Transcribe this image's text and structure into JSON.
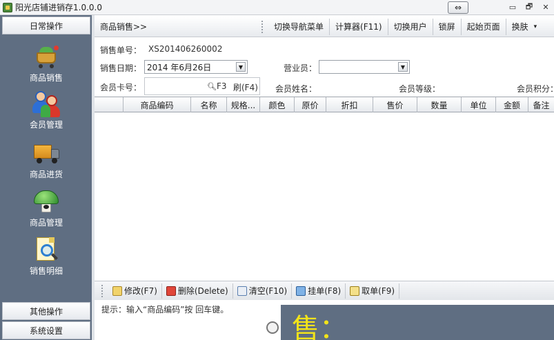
{
  "window": {
    "title": "阳光店铺进销存1.0.0.0",
    "nav_toggle": "⇔",
    "controls": [
      "▭",
      "🗗",
      "✕"
    ]
  },
  "sidebar": {
    "header": "日常操作",
    "items": [
      {
        "label": "商品销售",
        "icon": "shopping-cart-icon"
      },
      {
        "label": "会员管理",
        "icon": "members-icon"
      },
      {
        "label": "商品进货",
        "icon": "truck-icon"
      },
      {
        "label": "商品管理",
        "icon": "product-icon"
      },
      {
        "label": "销售明细",
        "icon": "sales-detail-icon"
      }
    ],
    "footer_items": [
      "其他操作",
      "系统设置"
    ]
  },
  "toolbar": {
    "breadcrumb": "商品销售>>",
    "buttons": [
      "切换导航菜单",
      "计算器(F11)",
      "切换用户",
      "锁屏",
      "起始页面",
      "换肤"
    ],
    "skin_dropdown": "▾"
  },
  "form": {
    "order_no_label": "销售单号：",
    "order_no": "XS201406260002",
    "date_label": "销售日期：",
    "date_value": "2014 年6月26日",
    "salesperson_label": "营业员：",
    "salesperson_value": "",
    "card_label": "会员卡号：",
    "card_value": "",
    "search_hint": "F3",
    "refresh": "刷(F4)",
    "member_name_label": "会员姓名：",
    "member_level_label": "会员等级：",
    "member_points_label": "会员积分："
  },
  "grid": {
    "columns": [
      "",
      "商品编码",
      "名称",
      "规格...",
      "颜色",
      "原价",
      "折扣",
      "售价",
      "数量",
      "单位",
      "金额",
      "备注"
    ],
    "rows": []
  },
  "actions": [
    "修改(F7)",
    "删除(Delete)",
    "清空(F10)",
    "挂单(F8)",
    "取单(F9)"
  ],
  "hint": "提示：输入“商品编码”按 回车键。",
  "total_label": "售："
}
